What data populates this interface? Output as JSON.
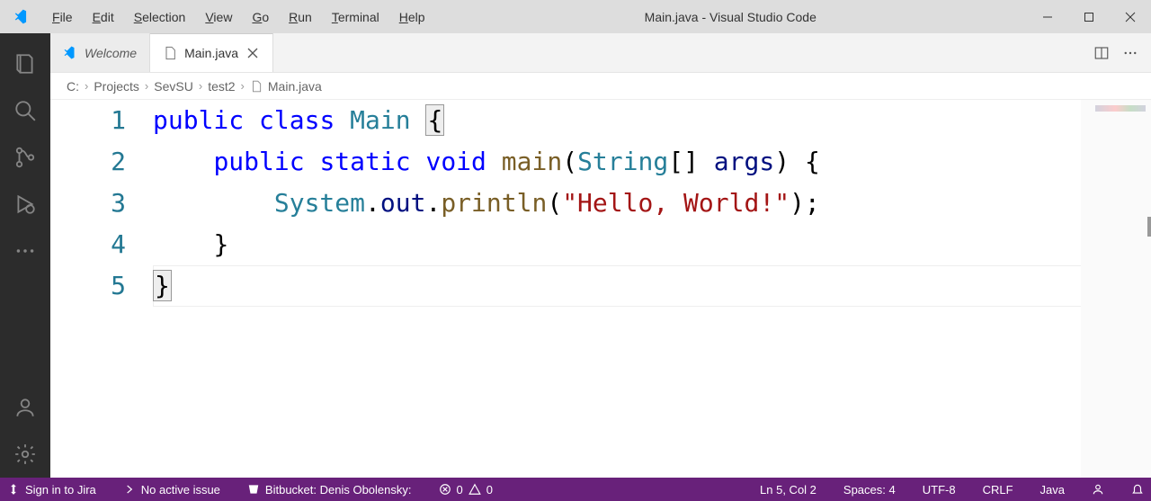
{
  "window": {
    "title": "Main.java - Visual Studio Code"
  },
  "menu": {
    "items": [
      {
        "label": "File",
        "underline": "F"
      },
      {
        "label": "Edit",
        "underline": "E"
      },
      {
        "label": "Selection",
        "underline": "S"
      },
      {
        "label": "View",
        "underline": "V"
      },
      {
        "label": "Go",
        "underline": "G"
      },
      {
        "label": "Run",
        "underline": "R"
      },
      {
        "label": "Terminal",
        "underline": "T"
      },
      {
        "label": "Help",
        "underline": "H"
      }
    ]
  },
  "tabs": {
    "welcome": "Welcome",
    "main": "Main.java"
  },
  "breadcrumb": {
    "parts": [
      "C:",
      "Projects",
      "SevSU",
      "test2",
      "Main.java"
    ]
  },
  "code": {
    "lines": [
      {
        "n": 1,
        "tokens": [
          [
            "kw",
            "public"
          ],
          [
            "sp",
            " "
          ],
          [
            "kw",
            "class"
          ],
          [
            "sp",
            " "
          ],
          [
            "type",
            "Main"
          ],
          [
            "sp",
            " "
          ],
          [
            "brace",
            "{"
          ]
        ]
      },
      {
        "n": 2,
        "tokens": [
          [
            "sp",
            "    "
          ],
          [
            "kw",
            "public"
          ],
          [
            "sp",
            " "
          ],
          [
            "kw",
            "static"
          ],
          [
            "sp",
            " "
          ],
          [
            "kw",
            "void"
          ],
          [
            "sp",
            " "
          ],
          [
            "fn",
            "main"
          ],
          [
            "punct",
            "("
          ],
          [
            "type",
            "String"
          ],
          [
            "punct",
            "[] "
          ],
          [
            "ident",
            "args"
          ],
          [
            "punct",
            ") {"
          ]
        ]
      },
      {
        "n": 3,
        "tokens": [
          [
            "sp",
            "        "
          ],
          [
            "type",
            "System"
          ],
          [
            "punct",
            "."
          ],
          [
            "ident",
            "out"
          ],
          [
            "punct",
            "."
          ],
          [
            "fn",
            "println"
          ],
          [
            "punct",
            "("
          ],
          [
            "str",
            "\"Hello, World!\""
          ],
          [
            "punct",
            ");"
          ]
        ]
      },
      {
        "n": 4,
        "tokens": [
          [
            "sp",
            "    "
          ],
          [
            "punct",
            "}"
          ]
        ]
      },
      {
        "n": 5,
        "tokens": [
          [
            "brace",
            "}"
          ]
        ]
      }
    ]
  },
  "status": {
    "jira": "Sign in to Jira",
    "issue": "No active issue",
    "bitbucket": "Bitbucket: Denis Obolensky:",
    "errors": "0",
    "warnings": "0",
    "cursor": "Ln 5, Col 2",
    "spaces": "Spaces: 4",
    "encoding": "UTF-8",
    "eol": "CRLF",
    "language": "Java"
  }
}
